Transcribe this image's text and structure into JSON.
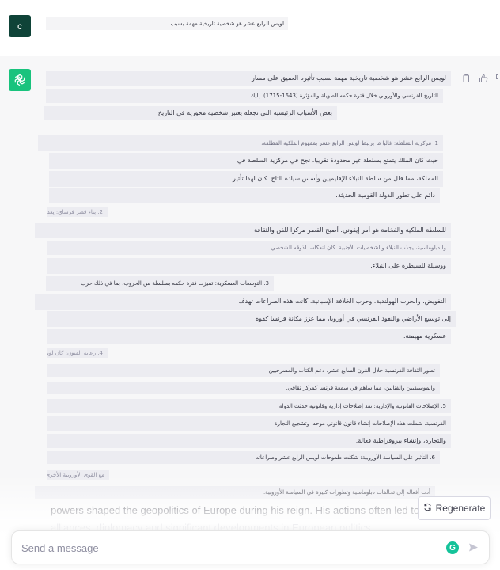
{
  "user": {
    "avatar_letter": "c",
    "prompt": "لويس الرابع عشر هو شخصية تاريخية مهمة بسبب"
  },
  "assistant": {
    "lines": [
      "لويس الرابع عشر هو شخصية تاريخية مهمة بسبب تأثيره العميق على مسار",
      "التاريخ الفرنسي والأوروبي خلال فترة حكمه الطويلة والمؤثرة (1643-1715). إليك",
      "بعض الأسباب الرئيسية التي تجعله يعتبر شخصية محورية في التاريخ:",
      "1. مركزية السلطة: غالبا ما يرتبط لويس الرابع عشر بمفهوم الملكية المطلقة،",
      "حيث كان الملك يتمتع بسلطة غير محدودة تقريبا. نجح في مركزية السلطة في",
      "المملكة، مما قلل من سلطة النبلاء الإقليميين وأسس سيادة التاج. كان لهذا تأثير",
      "دائم على تطور الدولة القومية الحديثة.",
      "2. بناء قصر فرساي: يعد قصر فرساي رمزا",
      "للسلطة الملكية والفخامة هو أمر إيقوني. أصبح القصر مركزا للفن والثقافة",
      "والدبلوماسية، يجذب النبلاء والشخصيات الأجنبية. كان انعكاسا لذوقه الشخصي",
      "ووسيلة للسيطرة على النبلاء.",
      "3. التوسعات العسكرية: تميزت فترة حكمه بسلسلة من الحروب، بما في ذلك حرب",
      "التفويض، والحرب الهولندية، وحرب الخلافة الإسبانية. كانت هذه الصراعات تهدف",
      "إلى توسيع الأراضي والنفوذ الفرنسي في أوروبا، مما عزز مكانة فرنسا كقوة",
      "عسكرية مهيمنة.",
      "4. رعاية الفنون: كان لويس",
      "تطور الثقافة الفرنسية خلال القرن السابع عشر. دعم الكتاب والمسرحيين",
      "والموسيقيين والفنانين، مما ساهم في سمعة فرنسا كمركز ثقافي.",
      "5. الإصلاحات القانونية والإدارية: نفذ إصلاحات إدارية وقانونية حدثت الدولة",
      "الفرنسية. شملت هذه الإصلاحات إنشاء قانون قانوني موحد، وتشجيع التجارة",
      "والتجارة، وإنشاء بيروقراطية فعالة.",
      "6. التأثير على السياسة الأوروبية: شكلت طموحات لويس الرابع عشر وصراعاته",
      "مع القوى الأوروبية الأخرى",
      "أدت أفعاله إلى تحالفات دبلوماسية وتطورات كبيرة في السياسة الأوروبية."
    ],
    "english_lines": [
      "powers shaped the geopolitics of Europe during his reign. His actions often led to sh",
      "alliances, diplomacy and significant developments in European politics"
    ],
    "actions": {
      "copy": "copy-icon",
      "thumbs_up": "thumbs-up-icon"
    }
  },
  "regenerate": {
    "label": "Regenerate"
  },
  "composer": {
    "placeholder": "Send a message",
    "grammarly_letter": "G"
  },
  "colors": {
    "accent": "#19c37d",
    "user_avatar": "#0f4338",
    "grammarly": "#15c39a"
  }
}
